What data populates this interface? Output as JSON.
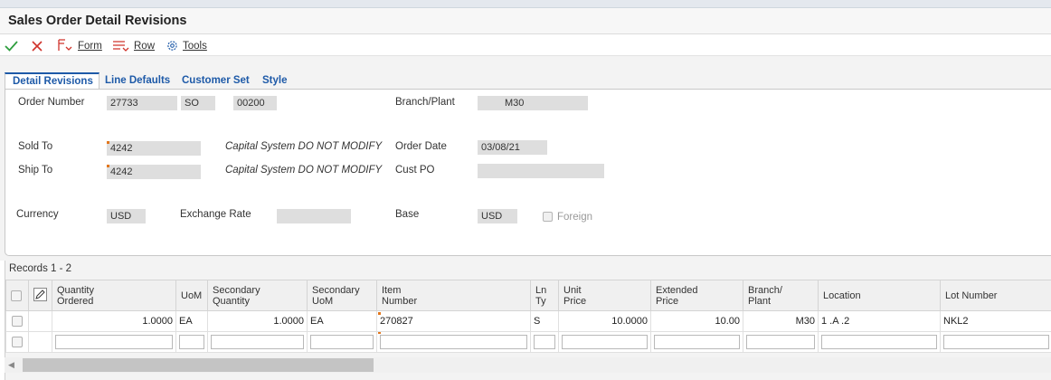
{
  "window": {
    "title": "Sales Order Detail Revisions"
  },
  "toolbar": {
    "form_label": "Form",
    "row_label": "Row",
    "tools_label": "Tools"
  },
  "tabs": [
    {
      "label": "Detail Revisions",
      "active": true
    },
    {
      "label": "Line Defaults"
    },
    {
      "label": "Customer Set"
    },
    {
      "label": "Style"
    }
  ],
  "form": {
    "order_number_label": "Order Number",
    "order_number": "27733",
    "order_type": "SO",
    "order_company": "00200",
    "branch_plant_label": "Branch/Plant",
    "branch_plant": "M30",
    "sold_to_label": "Sold To",
    "sold_to": "4242",
    "sold_to_desc": "Capital System DO NOT MODIFY",
    "order_date_label": "Order Date",
    "order_date": "03/08/21",
    "ship_to_label": "Ship To",
    "ship_to": "4242",
    "ship_to_desc": "Capital System DO NOT MODIFY",
    "cust_po_label": "Cust PO",
    "cust_po": "",
    "currency_label": "Currency",
    "currency": "USD",
    "exchange_rate_label": "Exchange Rate",
    "exchange_rate": "",
    "base_label": "Base",
    "base": "USD",
    "foreign_label": "Foreign"
  },
  "grid": {
    "records_label": "Records 1 - 2",
    "columns": {
      "qty_1": "Quantity",
      "qty_2": "Ordered",
      "uom": "UoM",
      "sec_qty_1": "Secondary",
      "sec_qty_2": "Quantity",
      "sec_uom_1": "Secondary",
      "sec_uom_2": "UoM",
      "item_1": "Item",
      "item_2": "Number",
      "ln_1": "Ln",
      "ln_2": "Ty",
      "unit_1": "Unit",
      "unit_2": "Price",
      "ext_1": "Extended",
      "ext_2": "Price",
      "bp_1": "Branch/",
      "bp_2": "Plant",
      "location": "Location",
      "lot": "Lot Number"
    },
    "rows": [
      {
        "quantity_ordered": "1.0000",
        "uom": "EA",
        "secondary_quantity": "1.0000",
        "secondary_uom": "EA",
        "item_number": "270827",
        "line_type": "S",
        "unit_price": "10.0000",
        "extended_price": "10.00",
        "branch_plant": "M30",
        "location": "1 .A .2",
        "lot_number": "NKL2"
      }
    ]
  },
  "colors": {
    "accent": "#1e5aa8",
    "required_marker": "#e2771e",
    "ok_green": "#2e9e3e",
    "cancel_red": "#d0342c"
  }
}
